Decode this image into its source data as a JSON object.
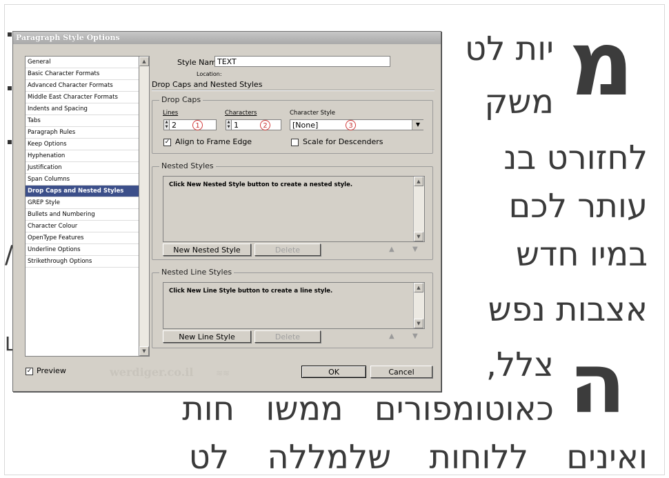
{
  "document": {
    "lines": [
      "יות לט",
      "משק",
      "לחזורט בנ",
      "עותר לכם",
      "במיו חדש",
      "אצבות נפש",
      "צלל,",
      "כאוטומפורים ממשו חות",
      "ואינים ללוחות שלמללה לט"
    ],
    "dropcap_1": "מ",
    "dropcap_2": "ה",
    "left_edge_glyph_1": "/",
    "left_edge_glyph_2": "L"
  },
  "dialog": {
    "title": "Paragraph Style Options",
    "categories": [
      "General",
      "Basic Character Formats",
      "Advanced Character Formats",
      "Middle East Character Formats",
      "Indents and Spacing",
      "Tabs",
      "Paragraph Rules",
      "Keep Options",
      "Hyphenation",
      "Justification",
      "Span Columns",
      "Drop Caps and Nested Styles",
      "GREP Style",
      "Bullets and Numbering",
      "Character Colour",
      "OpenType Features",
      "Underline Options",
      "Strikethrough Options"
    ],
    "selected_category": "Drop Caps and Nested Styles",
    "style_name_label": "Style Name:",
    "style_name_value": "TEXT",
    "location_label": "Location:",
    "section_title": "Drop Caps and Nested Styles",
    "drop_caps": {
      "group_title": "Drop Caps",
      "lines_label": "Lines",
      "lines_value": "2",
      "characters_label": "Characters",
      "characters_value": "1",
      "character_style_label": "Character Style",
      "character_style_value": "[None]",
      "markers": [
        "1",
        "2",
        "3"
      ],
      "align_label": "Align to Frame Edge",
      "align_checked": true,
      "scale_label": "Scale for Descenders",
      "scale_checked": false
    },
    "nested_styles": {
      "group_title": "Nested Styles",
      "hint": "Click New Nested Style button to create a nested style.",
      "new_button": "New Nested Style",
      "delete_button": "Delete"
    },
    "nested_line_styles": {
      "group_title": "Nested Line Styles",
      "hint": "Click New Line Style button to create a line style.",
      "new_button": "New Line Style",
      "delete_button": "Delete"
    },
    "preview_label": "Preview",
    "preview_checked": true,
    "ok_button": "OK",
    "cancel_button": "Cancel",
    "watermark": "werdiger.co.il"
  }
}
